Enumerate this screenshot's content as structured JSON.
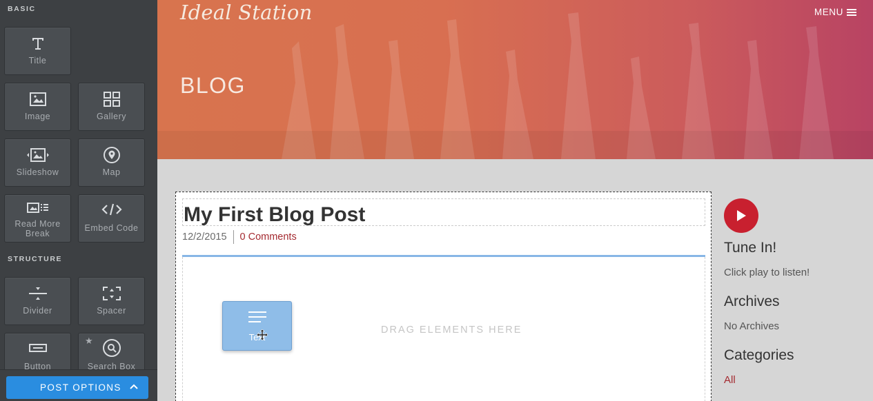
{
  "sidebar": {
    "sections": {
      "basic": "BASIC",
      "structure": "STRUCTURE"
    },
    "tiles": {
      "title": "Title",
      "image": "Image",
      "gallery": "Gallery",
      "slideshow": "Slideshow",
      "map": "Map",
      "read_more": "Read More Break",
      "embed_code": "Embed Code",
      "divider": "Divider",
      "spacer": "Spacer",
      "button": "Button",
      "search_box": "Search Box"
    },
    "post_options": "POST OPTIONS"
  },
  "header": {
    "site_title": "Ideal Station",
    "menu": "MENU",
    "page_heading": "BLOG"
  },
  "post": {
    "title": "My First Blog Post",
    "date": "12/2/2015",
    "comments": "0 Comments",
    "drop_hint": "DRAG ELEMENTS HERE"
  },
  "dragging_tile": {
    "label": "Text"
  },
  "right_sidebar": {
    "tune_in_heading": "Tune In!",
    "tune_in_text": "Click play to listen!",
    "archives_heading": "Archives",
    "archives_text": "No Archives",
    "categories_heading": "Categories",
    "categories_all": "All"
  },
  "colors": {
    "accent_blue": "#2a8de0",
    "link_red": "#a42a30",
    "play_red": "#c8202f",
    "sidebar_bg": "#3d4043"
  }
}
